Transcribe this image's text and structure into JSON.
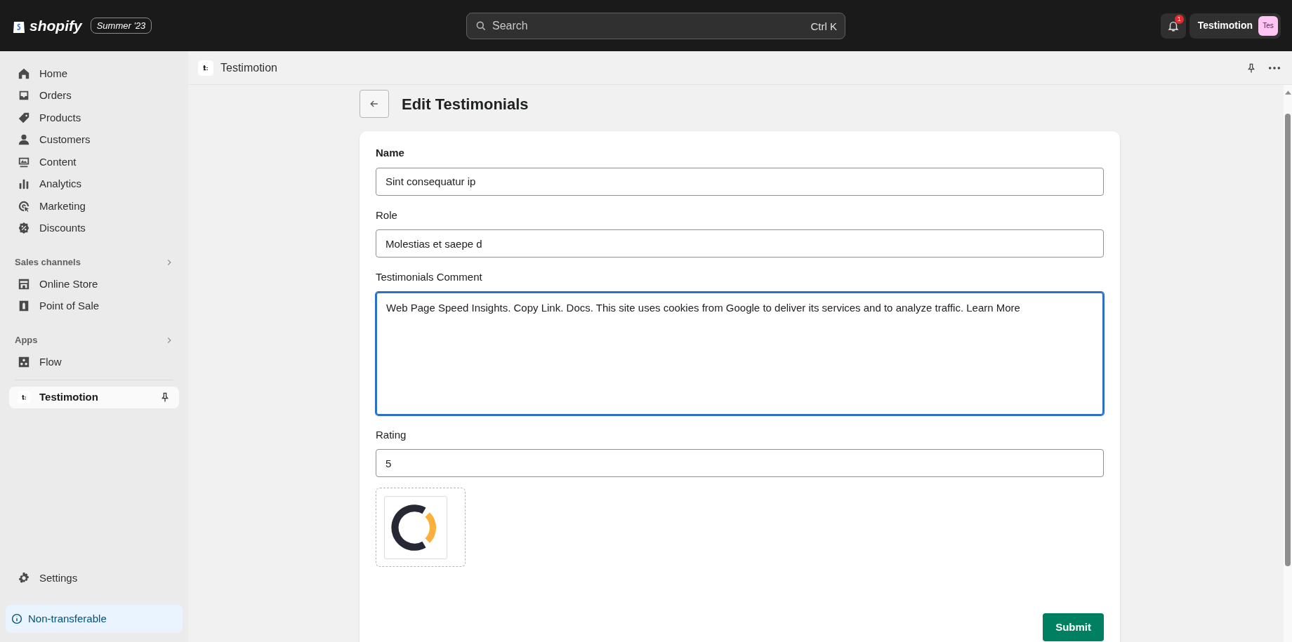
{
  "topbar": {
    "brand": "shopify",
    "edition": "Summer '23",
    "search": {
      "placeholder": "Search",
      "shortcut": "Ctrl K"
    },
    "notifications": "1",
    "store": "Testimotion",
    "avatar": "Tes"
  },
  "sidebar": {
    "items": [
      {
        "label": "Home",
        "selected": false
      },
      {
        "label": "Orders",
        "selected": false
      },
      {
        "label": "Products",
        "selected": false
      },
      {
        "label": "Customers",
        "selected": false
      },
      {
        "label": "Content",
        "selected": false
      },
      {
        "label": "Analytics",
        "selected": false
      },
      {
        "label": "Marketing",
        "selected": false
      },
      {
        "label": "Discounts",
        "selected": false
      }
    ],
    "sections": [
      {
        "label": "Sales channels",
        "items": [
          {
            "label": "Online Store",
            "selected": false
          },
          {
            "label": "Point of Sale",
            "selected": false
          }
        ]
      },
      {
        "label": "Apps",
        "items": [
          {
            "label": "Flow",
            "selected": false
          }
        ]
      }
    ],
    "pinned": [
      {
        "label": "Testimotion",
        "selected": true
      }
    ],
    "settings": "Settings",
    "notice": "Non-transferable"
  },
  "app_header": {
    "title": "Testimotion"
  },
  "page": {
    "title": "Edit Testimonials",
    "fields": [
      {
        "label": "Name",
        "kind": "input",
        "value": "Sint consequatur ip",
        "focused": false,
        "bold_label": true
      },
      {
        "label": "Role",
        "kind": "input",
        "value": "Molestias et saepe d",
        "focused": false,
        "bold_label": false
      },
      {
        "label": "Testimonials Comment",
        "kind": "textarea",
        "value": "Web Page Speed Insights. Copy Link. Docs. This site uses cookies from Google to deliver its services and to analyze traffic. Learn More",
        "focused": true,
        "bold_label": false
      },
      {
        "label": "Rating",
        "kind": "input",
        "value": "5",
        "focused": false,
        "bold_label": false
      }
    ],
    "submit": "Submit"
  }
}
